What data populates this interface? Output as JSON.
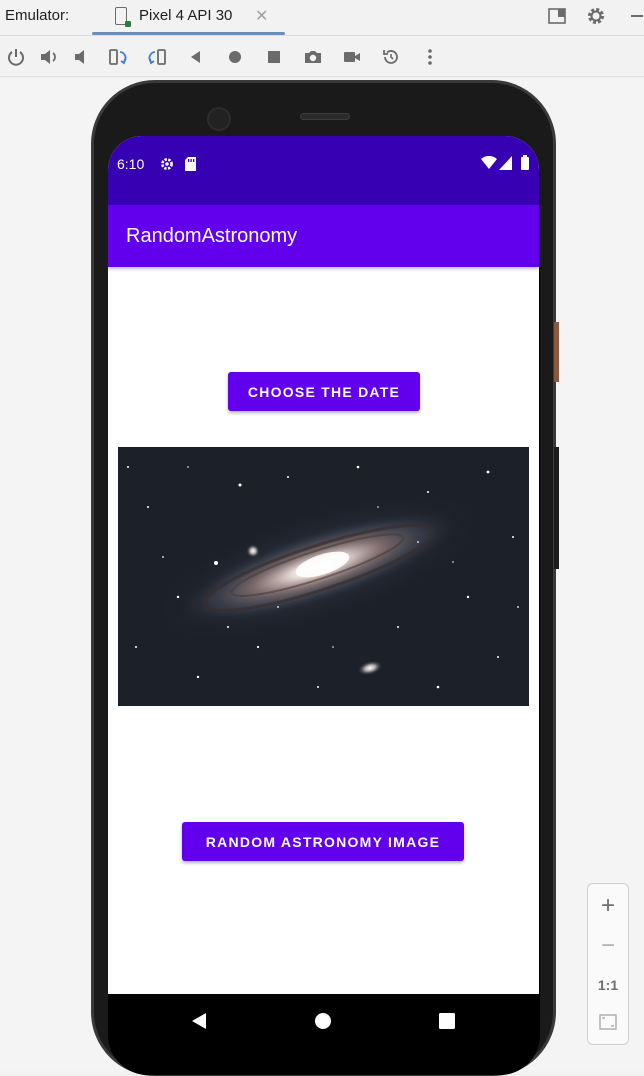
{
  "ide": {
    "panel_label": "Emulator:",
    "device_tab": "Pixel 4 API 30",
    "tab_close": "✕"
  },
  "toolbar": {
    "buttons": [
      "power-icon",
      "volume-up-icon",
      "volume-down-icon",
      "rotate-left-icon",
      "rotate-right-icon",
      "back-icon",
      "home-icon",
      "overview-icon",
      "camera-icon",
      "video-icon",
      "snapshot-icon",
      "more-icon"
    ]
  },
  "app": {
    "status_time": "6:10",
    "title": "RandomAstronomy",
    "choose_button": "CHOOSE THE DATE",
    "random_button": "RANDOM ASTRONOMY IMAGE",
    "colors": {
      "primary": "#6200ee",
      "primary_dark": "#3700b3"
    }
  },
  "zoom": {
    "zoom_in": "+",
    "zoom_out": "−",
    "actual_size": "1:1"
  }
}
